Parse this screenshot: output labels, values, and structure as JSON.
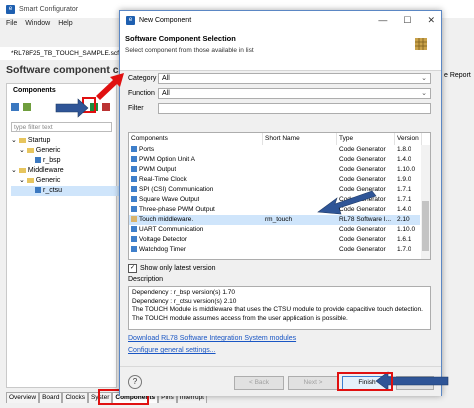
{
  "bg": {
    "title": "Smart Configurator",
    "menu": [
      "File",
      "Window",
      "Help"
    ],
    "file_tab": "*RL78F25_TB_TOUCH_SAMPLE.scfg",
    "heading": "Software component confi",
    "panel_title": "Components",
    "filter_placeholder": "type filter text",
    "tree": [
      {
        "label": "Startup",
        "level": 1
      },
      {
        "label": "Generic",
        "level": 2
      },
      {
        "label": "r_bsp",
        "level": 3
      },
      {
        "label": "Middleware",
        "level": 1
      },
      {
        "label": "Generic",
        "level": 2
      },
      {
        "label": "r_ctsu",
        "level": 3
      }
    ],
    "bottom_tabs": [
      "Overview",
      "Board",
      "Clocks",
      "Syster",
      "Components",
      "Pins",
      "Interrupt"
    ],
    "right_text": "e Report"
  },
  "dialog": {
    "title": "New Component",
    "heading": "Software Component Selection",
    "subheading": "Select component from those available in list",
    "category_label": "Category",
    "category_value": "All",
    "function_label": "Function",
    "function_value": "All",
    "filter_label": "Filter",
    "filter_value": "",
    "columns": [
      "Components",
      "Short Name",
      "Type",
      "Version"
    ],
    "rows": [
      {
        "name": "Ports",
        "short": "",
        "type": "Code Generator",
        "version": "1.8.0"
      },
      {
        "name": "PWM Option Unit A",
        "short": "",
        "type": "Code Generator",
        "version": "1.4.0"
      },
      {
        "name": "PWM Output",
        "short": "",
        "type": "Code Generator",
        "version": "1.10.0"
      },
      {
        "name": "Real-Time Clock",
        "short": "",
        "type": "Code Generator",
        "version": "1.9.0"
      },
      {
        "name": "SPI (CSI) Communication",
        "short": "",
        "type": "Code Generator",
        "version": "1.7.1"
      },
      {
        "name": "Square Wave Output",
        "short": "",
        "type": "Code Generator",
        "version": "1.7.1"
      },
      {
        "name": "Three-phase PWM Output",
        "short": "",
        "type": "Code Generator",
        "version": "1.4.0"
      },
      {
        "name": "Touch middleware.",
        "short": "rm_touch",
        "type": "RL78 Software I...",
        "version": "2.10"
      },
      {
        "name": "UART Communication",
        "short": "",
        "type": "Code Generator",
        "version": "1.10.0"
      },
      {
        "name": "Voltage Detector",
        "short": "",
        "type": "Code Generator",
        "version": "1.6.1"
      },
      {
        "name": "Watchdog Timer",
        "short": "",
        "type": "Code Generator",
        "version": "1.7.0"
      }
    ],
    "show_latest_label": "Show only latest version",
    "show_latest_checked": true,
    "description_label": "Description",
    "description_lines": [
      "Dependency : r_bsp version(s) 1.70",
      "Dependency : r_ctsu version(s) 2.10",
      "The TOUCH Module is middleware that uses the CTSU module to provide capacitive touch detection.",
      "The TOUCH module assumes access from the user application is possible."
    ],
    "link_download": "Download RL78 Software Integration System modules",
    "link_configure": "Configure general settings...",
    "btn_back": "< Back",
    "btn_next": "Next >",
    "btn_finish": "Finish",
    "btn_help": "?"
  },
  "colors": {
    "annotation_red": "#e01010",
    "annotation_arrow": "#2f5597",
    "selection": "#cfe5fb"
  }
}
